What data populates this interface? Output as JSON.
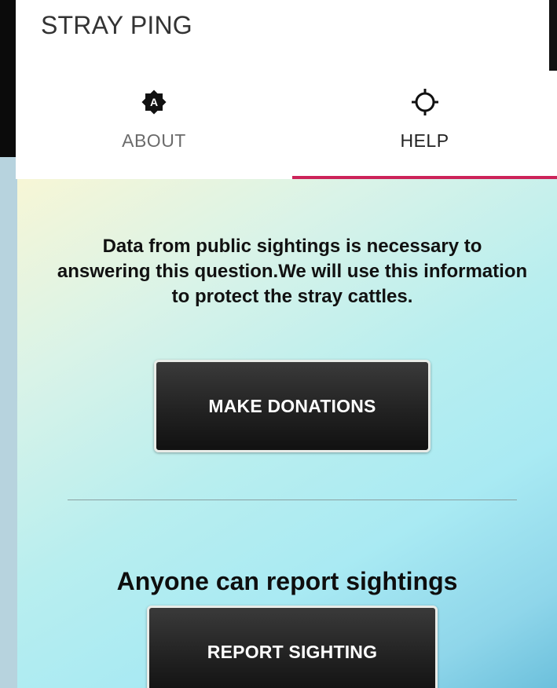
{
  "app": {
    "title": "STRAY PING"
  },
  "tabs": [
    {
      "label": "ABOUT",
      "icon": "brightness-auto-icon",
      "selected": false
    },
    {
      "label": "HELP",
      "icon": "crosshair-icon",
      "selected": true
    }
  ],
  "help": {
    "info_text": "Data from public sightings is necessary to answering this question.We will use this information to protect the stray cattles.",
    "donate_label": "MAKE DONATIONS",
    "report_heading": "Anyone can report sightings",
    "report_label": "REPORT SIGHTING"
  },
  "colors": {
    "tab_indicator": "#cc2359",
    "button_bg": "#222222"
  }
}
